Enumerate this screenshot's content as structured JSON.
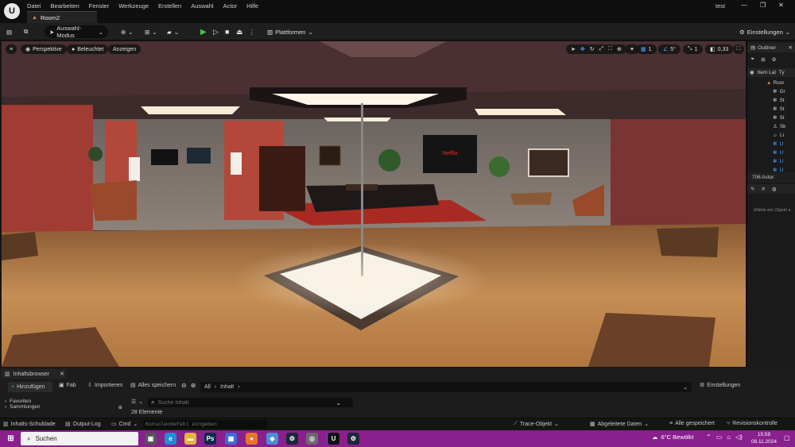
{
  "app": {
    "project": "test",
    "doc_tab": "Room2",
    "logo": "U"
  },
  "menu": [
    "Datei",
    "Bearbeiten",
    "Fenster",
    "Werkzeuge",
    "Erstellen",
    "Auswahl",
    "Actor",
    "Hilfe"
  ],
  "window_controls": {
    "minimize": "—",
    "restore": "❐",
    "close": "✕"
  },
  "toolbar": {
    "mode": "Auswahl-Modus",
    "platforms": "Plattformen",
    "settings": "Einstellungen"
  },
  "viewport": {
    "perspective": "Perspektive",
    "lit": "Beleuchtet",
    "show": "Anzeigen",
    "grid_value": "1",
    "angle_value": "5°",
    "scale_value": "1",
    "speed_value": "0,33",
    "tv_text": "Netflix"
  },
  "outliner": {
    "title": "Outliner",
    "col_label": "Item Lal",
    "col_type": "Ty",
    "root": "Roor",
    "items": [
      "Gr",
      "St",
      "St",
      "St",
      "Sk",
      "Li",
      "U",
      "U",
      "U",
      "U"
    ],
    "actor_count": "706 Actor",
    "details_hint": "Wähle ein Objekt a"
  },
  "content_browser": {
    "tab": "Inhaltsbrowser",
    "add": "Hinzufügen",
    "fab": "Fab",
    "import": "Importieren",
    "save_all": "Alles speichern",
    "path_all": "All",
    "path_content": "Inhalt",
    "settings": "Einstellungen",
    "tree_1": "Favoriten",
    "tree_2": "Sammlungen",
    "search_placeholder": "Suche Inhalt",
    "count": "28 Elemente"
  },
  "statusbar": {
    "drawer": "Inhalts-Schublade",
    "output": "Output-Log",
    "cmd": "Cmd",
    "console_placeholder": "Konsolenbefehl eingeben",
    "trace": "Trace-Objekt",
    "derived": "Abgeleitete Daten",
    "saved": "Alle gespeichert",
    "revision": "Revisionskontrolle"
  },
  "taskbar": {
    "search": "Suchen",
    "weather": "6°C Bewölkt",
    "time": "15:59",
    "date": "08.11.2024",
    "apps": [
      {
        "icon": "task-view-icon",
        "glyph": "▣",
        "color": "#555555"
      },
      {
        "icon": "edge-icon",
        "glyph": "e",
        "color": "#1f8fd6"
      },
      {
        "icon": "explorer-icon",
        "glyph": "▬",
        "color": "#e6b43c"
      },
      {
        "icon": "photoshop-icon",
        "glyph": "Ps",
        "color": "#0b2a4a"
      },
      {
        "icon": "store-icon",
        "glyph": "▦",
        "color": "#3a6ed6"
      },
      {
        "icon": "firefox-icon",
        "glyph": "●",
        "color": "#e8742a"
      },
      {
        "icon": "app-blue-icon",
        "glyph": "◆",
        "color": "#4a8fd6"
      },
      {
        "icon": "steam-icon",
        "glyph": "⚙",
        "color": "#1b2838"
      },
      {
        "icon": "app-gray-icon",
        "glyph": "◎",
        "color": "#6a6a6a"
      },
      {
        "icon": "discord-icon",
        "glyph": "◉",
        "color": "#5865f2"
      },
      {
        "icon": "unreal-icon",
        "glyph": "U",
        "color": "#111111"
      },
      {
        "icon": "steam2-icon",
        "glyph": "⚙",
        "color": "#1b2838"
      }
    ]
  }
}
